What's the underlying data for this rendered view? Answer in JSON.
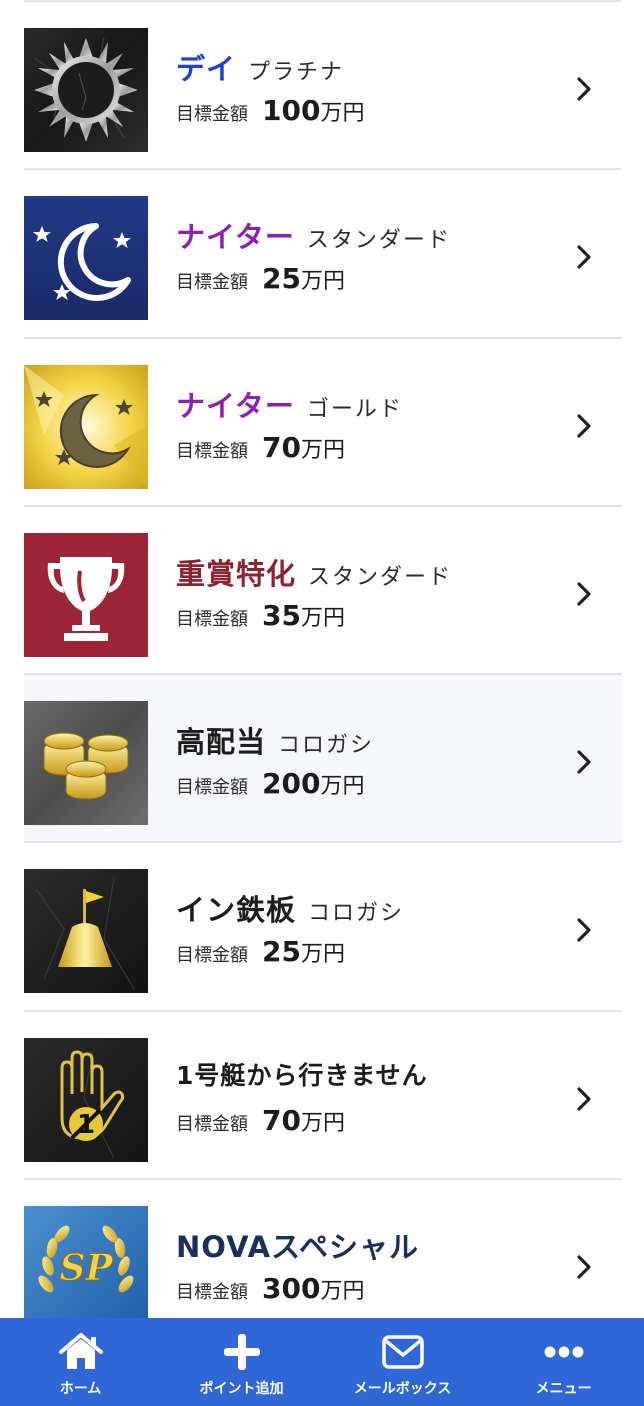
{
  "plans": [
    {
      "name": "デイ",
      "tier": "プラチナ",
      "target_label": "目標金額",
      "target_amount": "100",
      "target_unit": "万円",
      "name_color": "#1f3fd9",
      "icon": "sun-icon",
      "highlighted": false
    },
    {
      "name": "ナイター",
      "tier": "スタンダード",
      "target_label": "目標金額",
      "target_amount": "25",
      "target_unit": "万円",
      "name_color": "#8f1fb2",
      "icon": "moon-stars-icon",
      "highlighted": false
    },
    {
      "name": "ナイター",
      "tier": "ゴールド",
      "target_label": "目標金額",
      "target_amount": "70",
      "target_unit": "万円",
      "name_color": "#8f1fb2",
      "icon": "gold-moon-stars-icon",
      "highlighted": false
    },
    {
      "name": "重賞特化",
      "tier": "スタンダード",
      "target_label": "目標金額",
      "target_amount": "35",
      "target_unit": "万円",
      "name_color": "#8e2231",
      "icon": "trophy-icon",
      "highlighted": false
    },
    {
      "name": "高配当",
      "tier": "コロガシ",
      "target_label": "目標金額",
      "target_amount": "200",
      "target_unit": "万円",
      "name_color": "#1c1c1c",
      "icon": "coins-icon",
      "highlighted": true
    },
    {
      "name": "イン鉄板",
      "tier": "コロガシ",
      "target_label": "目標金額",
      "target_amount": "25",
      "target_unit": "万円",
      "name_color": "#1c1c1c",
      "icon": "flag-bell-icon",
      "highlighted": false
    },
    {
      "name": "1号艇から行きません",
      "tier": "",
      "target_label": "目標金額",
      "target_amount": "70",
      "target_unit": "万円",
      "name_color": "#1c1c1c",
      "icon": "hand-no-one-icon",
      "highlighted": false
    },
    {
      "name": "NOVAスペシャル",
      "tier": "",
      "target_label": "目標金額",
      "target_amount": "300",
      "target_unit": "万円",
      "name_color": "#1a2f5e",
      "icon": "sp-laurel-icon",
      "highlighted": false
    }
  ],
  "tabbar": {
    "bg_color": "#2f67d6",
    "tabs": [
      {
        "label": "ホーム",
        "icon": "home-icon"
      },
      {
        "label": "ポイント追加",
        "icon": "plus-icon"
      },
      {
        "label": "メールボックス",
        "icon": "mail-icon"
      },
      {
        "label": "メニュー",
        "icon": "more-dots-icon"
      }
    ]
  }
}
